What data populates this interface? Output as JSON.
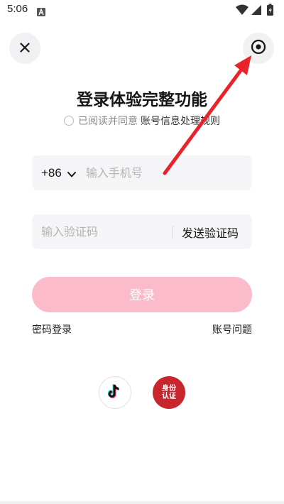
{
  "status_bar": {
    "time": "5:06",
    "notification_icon": "a-box-icon",
    "wifi_icon": "wifi-icon",
    "signal_icon": "signal-icon",
    "battery_icon": "battery-charging-icon"
  },
  "header": {
    "close_icon": "close-icon",
    "settings_icon": "target-settings-icon"
  },
  "title": "登录体验完整功能",
  "agreement": {
    "text": "已阅读并同意",
    "link": "账号信息处理规则"
  },
  "phone": {
    "country_code": "+86",
    "placeholder": "输入手机号",
    "value": ""
  },
  "code": {
    "placeholder": "输入验证码",
    "value": "",
    "send_label": "发送验证码"
  },
  "login_button": "登录",
  "links": {
    "password_login": "密码登录",
    "account_issue": "账号问题"
  },
  "third_party": {
    "douyin_icon": "douyin-icon",
    "id_auth_label": "身份认证"
  },
  "colors": {
    "accent": "#fcbbca",
    "field_bg": "#f5f5f7",
    "id_red": "#c8262d",
    "annotation_arrow": "#e8232b"
  }
}
